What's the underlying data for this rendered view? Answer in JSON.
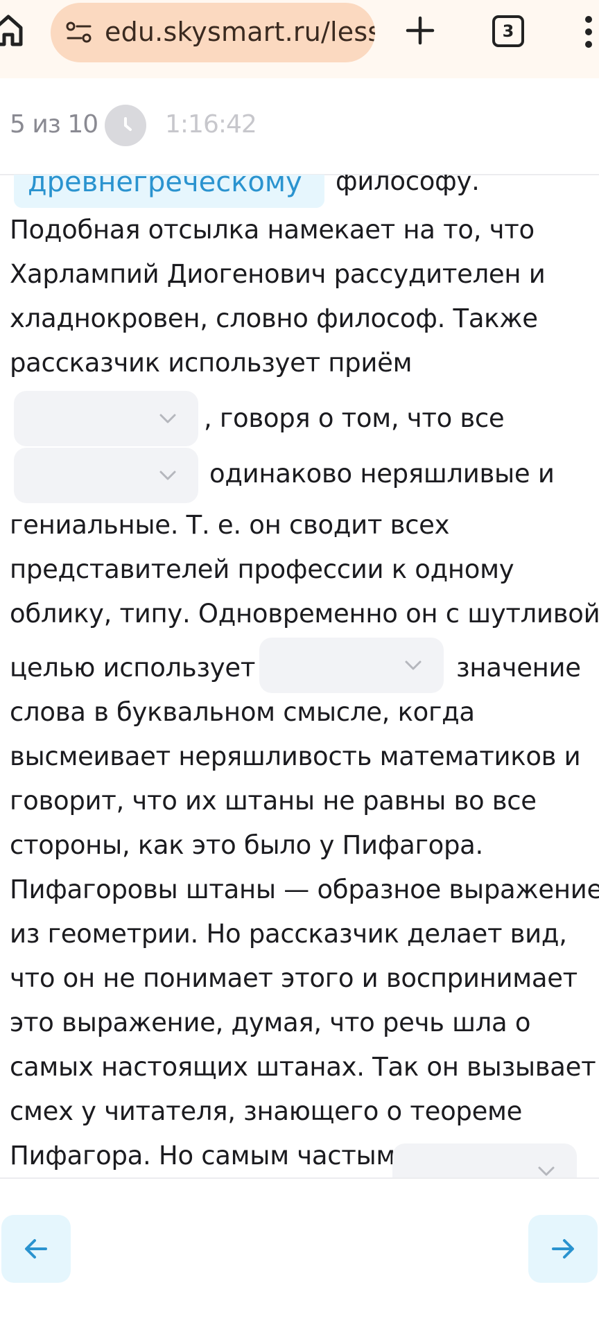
{
  "browser": {
    "url": "edu.skysmart.ru/less",
    "tab_count": "3"
  },
  "progress": {
    "position": "5 из 10",
    "timer": "1:16:42"
  },
  "content": {
    "highlight_word": "древнегреческому",
    "lines": [
      "философу.",
      "Подобная отсылка намекает на то, что",
      "Харлампий Диогенович рассудителен и",
      "хладнокровен, словно философ. Также",
      "рассказчик использует приём",
      ", говоря о том, что все",
      "одинаково неряшливые и",
      "гениальные. Т. е. он сводит всех",
      "представителей профессии к одному",
      "облику, типу. Одновременно он с шутливой",
      "целью использует",
      "значение",
      "слова в буквальном смысле, когда",
      "высмеивает неряшливость математиков и",
      "говорит, что их штаны не равны во все",
      "стороны, как это было у Пифагора.",
      "Пифагоровы штаны — образное выражение",
      "из геометрии. Но рассказчик делает вид,",
      "что он не понимает этого и воспринимает",
      "это выражение, думая, что речь шла о",
      "самых настоящих штанах. Так он вызывает",
      "смех у читателя, знающего о теореме",
      "Пифагора. Но самым частым"
    ]
  },
  "colors": {
    "accent": "#2a93cf",
    "chip_bg": "#e6f6fd",
    "urlbar_bg": "#fbd9c0",
    "dropdown_bg": "#f2f3f6"
  }
}
